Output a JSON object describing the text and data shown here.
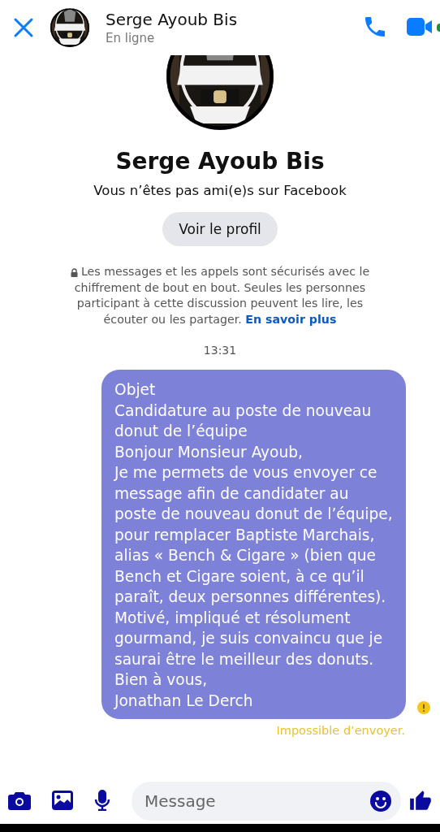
{
  "header": {
    "title": "Serge Ayoub Bis",
    "status": "En ligne"
  },
  "profile": {
    "name": "Serge Ayoub Bis",
    "relation": "Vous n’êtes pas ami(e)s sur Facebook",
    "button": "Voir le profil"
  },
  "security": {
    "text": "Les messages et les appels sont sécurisés avec le chiffrement de bout en bout. Seules les personnes participant à cette discussion peuvent les lire, les écouter ou les partager.",
    "link": "En savoir plus"
  },
  "timestamp": "13:31",
  "message": {
    "failed": true,
    "paragraphs": [
      "Objet",
      "Candidature au poste de nouveau donut de l’équipe",
      "Bonjour Monsieur Ayoub,",
      "Je me permets de vous envoyer ce message afin de candidater au poste de nouveau donut de l’équipe, pour remplacer Baptiste Marchais, alias « Bench & Cigare » (bien que Bench et Cigare soient, à ce qu’il paraît, deux personnes différentes).",
      "Motivé, impliqué et résolument gourmand, je suis convaincu que je saurai être le meilleur des donuts.",
      "Bien à vous,",
      "Jonathan Le Derch"
    ],
    "error": "Impossible d’envoyer."
  },
  "composer": {
    "placeholder": "Message"
  }
}
